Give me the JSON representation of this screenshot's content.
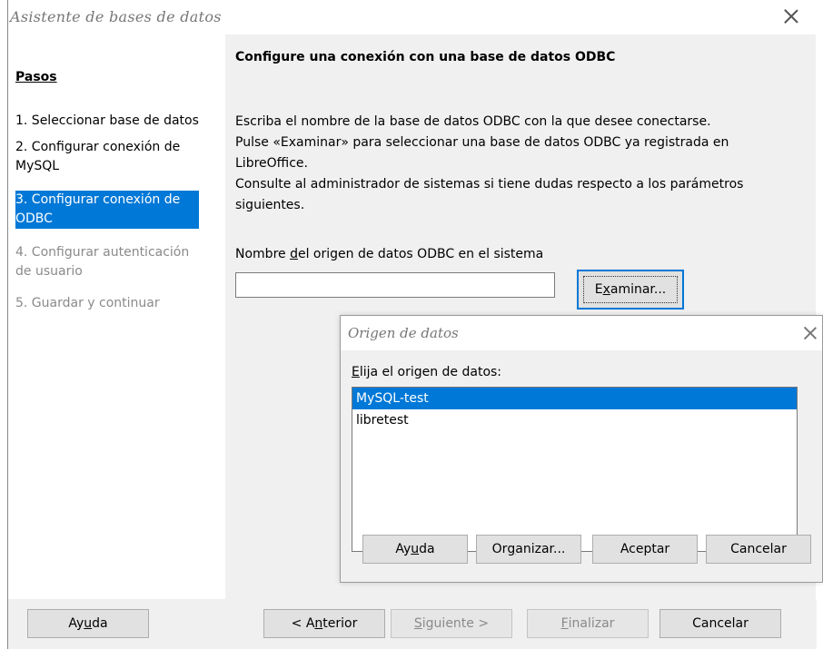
{
  "window": {
    "title": "Asistente de bases de datos"
  },
  "sidebar": {
    "title": "Pasos",
    "steps": [
      {
        "label": "1. Seleccionar base de datos"
      },
      {
        "label": "2. Configurar conexión de MySQL"
      },
      {
        "label": "3. Configurar conexión de ODBC"
      },
      {
        "label": "4. Configurar autenticación de usuario"
      },
      {
        "label": "5. Guardar y continuar"
      }
    ]
  },
  "main": {
    "heading": "Configure una conexión con una base de datos ODBC",
    "description_lines": [
      "Escriba el nombre de la base de datos ODBC con la que desee conectarse.",
      "Pulse «Examinar» para seleccionar una base de datos ODBC ya registrada en",
      "LibreOffice.",
      "Consulte al administrador de sistemas si tiene dudas respecto a los parámetros",
      "siguientes."
    ],
    "field_label_pre": "Nombre ",
    "field_label_mnemonic": "d",
    "field_label_post": "el origen de datos ODBC en el sistema",
    "field_value": "",
    "browse_pre": "E",
    "browse_mnemonic": "x",
    "browse_post": "aminar..."
  },
  "footer": {
    "help_pre": "Ay",
    "help_m": "u",
    "help_post": "da",
    "back_pre": "< A",
    "back_m": "n",
    "back_post": "terior",
    "next_pre": "",
    "next_m": "S",
    "next_post": "iguiente >",
    "finish_pre": "",
    "finish_m": "F",
    "finish_post": "inalizar",
    "cancel": "Cancelar"
  },
  "subdialog": {
    "title": "Origen de datos",
    "label_m": "E",
    "label_post": "lija el origen de datos:",
    "items": [
      "MySQL-test",
      "libretest"
    ],
    "help_pre": "Ay",
    "help_m": "u",
    "help_post": "da",
    "organize_pre": "Or",
    "organize_m": "g",
    "organize_post": "anizar...",
    "ok": "Aceptar",
    "cancel": "Cancelar"
  },
  "colors": {
    "accent": "#0078d7",
    "disabled_text": "#8a8a8a"
  }
}
